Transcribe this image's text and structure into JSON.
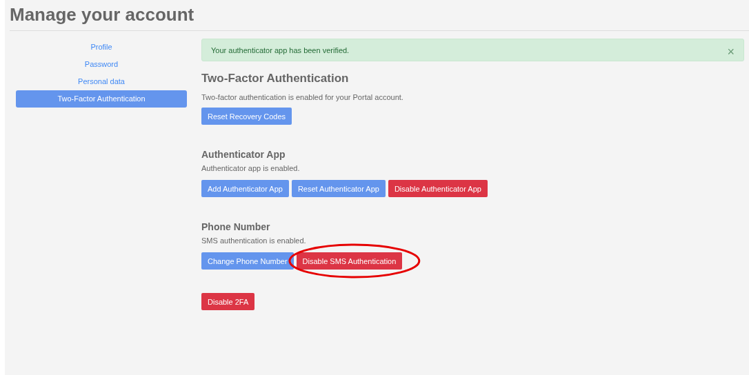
{
  "page_title": "Manage your account",
  "nav": [
    {
      "label": "Profile",
      "selected": false
    },
    {
      "label": "Password",
      "selected": false
    },
    {
      "label": "Personal data",
      "selected": false
    },
    {
      "label": "Two-Factor Authentication",
      "selected": true
    }
  ],
  "alert": {
    "message": "Your authenticator app has been verified.",
    "close": "×"
  },
  "heading": "Two-Factor Authentication",
  "sections": [
    {
      "status": "Two-factor authentication is enabled for your Portal account.",
      "buttons": [
        {
          "label": "Reset Recovery Codes",
          "kind": "primary",
          "highlighted": false
        }
      ]
    },
    {
      "title": "Authenticator App",
      "status": "Authenticator app is enabled.",
      "buttons": [
        {
          "label": "Add Authenticator App",
          "kind": "primary",
          "highlighted": false
        },
        {
          "label": "Reset Authenticator App",
          "kind": "primary",
          "highlighted": false
        },
        {
          "label": "Disable Authenticator App",
          "kind": "danger",
          "highlighted": false
        }
      ]
    },
    {
      "title": "Phone Number",
      "status": "SMS authentication is enabled.",
      "buttons": [
        {
          "label": "Change Phone Number",
          "kind": "primary",
          "highlighted": false
        },
        {
          "label": "Disable SMS Authentication",
          "kind": "danger",
          "highlighted": true
        }
      ]
    },
    {
      "buttons": [
        {
          "label": "Disable 2FA",
          "kind": "danger",
          "highlighted": false
        }
      ]
    }
  ]
}
